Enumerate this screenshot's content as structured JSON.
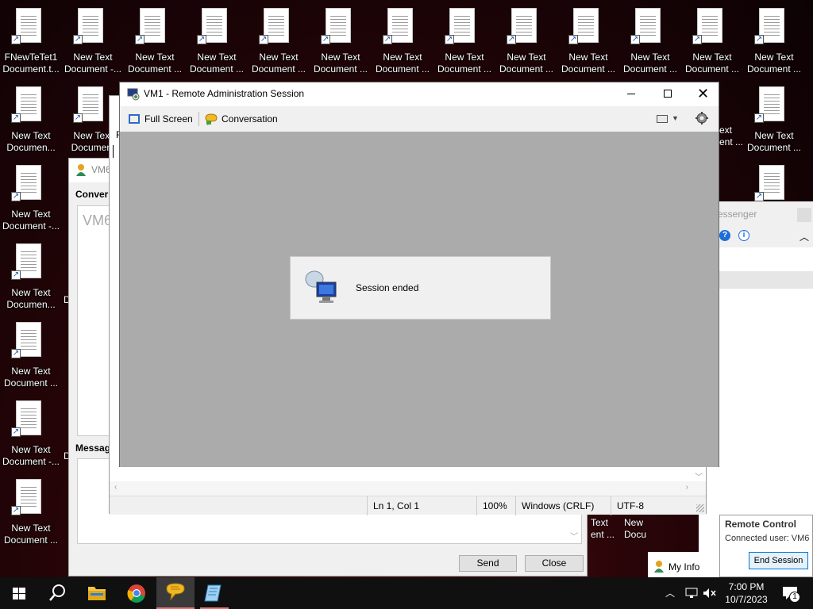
{
  "desktop": {
    "icons": [
      {
        "label": "FNewTeTet1\nDocument.t..."
      },
      {
        "label": "New Text\nDocument -..."
      },
      {
        "label": "New Text\nDocument ..."
      },
      {
        "label": "New Text\nDocument ..."
      },
      {
        "label": "New Text\nDocument ..."
      },
      {
        "label": "New Text\nDocument ..."
      },
      {
        "label": "New Text\nDocument ..."
      },
      {
        "label": "New Text\nDocument ..."
      },
      {
        "label": "New Text\nDocument ..."
      },
      {
        "label": "New Text\nDocument ..."
      },
      {
        "label": "New Text\nDocument ..."
      },
      {
        "label": "New Text\nDocument ..."
      },
      {
        "label": "New Text\nDocument ..."
      },
      {
        "label": "New Text\nDocumen..."
      },
      {
        "label": "New Text\nDocument"
      },
      {
        "label": "New Text\nDocument ..."
      },
      {
        "label": "New Text\nDocument -..."
      },
      {
        "label": "New Text\nDocumen..."
      },
      {
        "label": "New Text\nDocument ..."
      },
      {
        "label": "New Text\nDocument -..."
      },
      {
        "label": "New Text\nDocument ..."
      }
    ],
    "partial": {
      "text1": "ext",
      "text2": "ent ...",
      "text3": "ext",
      "text4": "ent ...",
      "text5": "Text",
      "text6": "New",
      "text7": "Docu",
      "d1": "D",
      "d2": "D"
    }
  },
  "conversation_window": {
    "title": "VM6",
    "conversation_label": "Convers",
    "log_text": "VM6",
    "message_label": "Message",
    "send_label": "Send",
    "close_label": "Close"
  },
  "notepad": {
    "file_letter": "F",
    "status": {
      "position": "Ln 1, Col 1",
      "zoom": "100%",
      "line_ending": "Windows (CRLF)",
      "encoding": "UTF-8"
    }
  },
  "messenger": {
    "title": "essenger"
  },
  "ras": {
    "title": "VM1 - Remote Administration Session",
    "full_screen_label": "Full Screen",
    "conversation_label": "Conversation",
    "dialog_text": "Session ended"
  },
  "remote_control": {
    "title": "Remote Control",
    "connected_user": "Connected user: VM6",
    "end_session_label": "End Session",
    "my_info_label": "My Info"
  },
  "taskbar": {
    "time": "7:00 PM",
    "date": "10/7/2023",
    "notification_count": "1"
  },
  "colors": {
    "accent": "#0078d7",
    "desktop": "#2a0508",
    "canvas": "#ababab"
  }
}
